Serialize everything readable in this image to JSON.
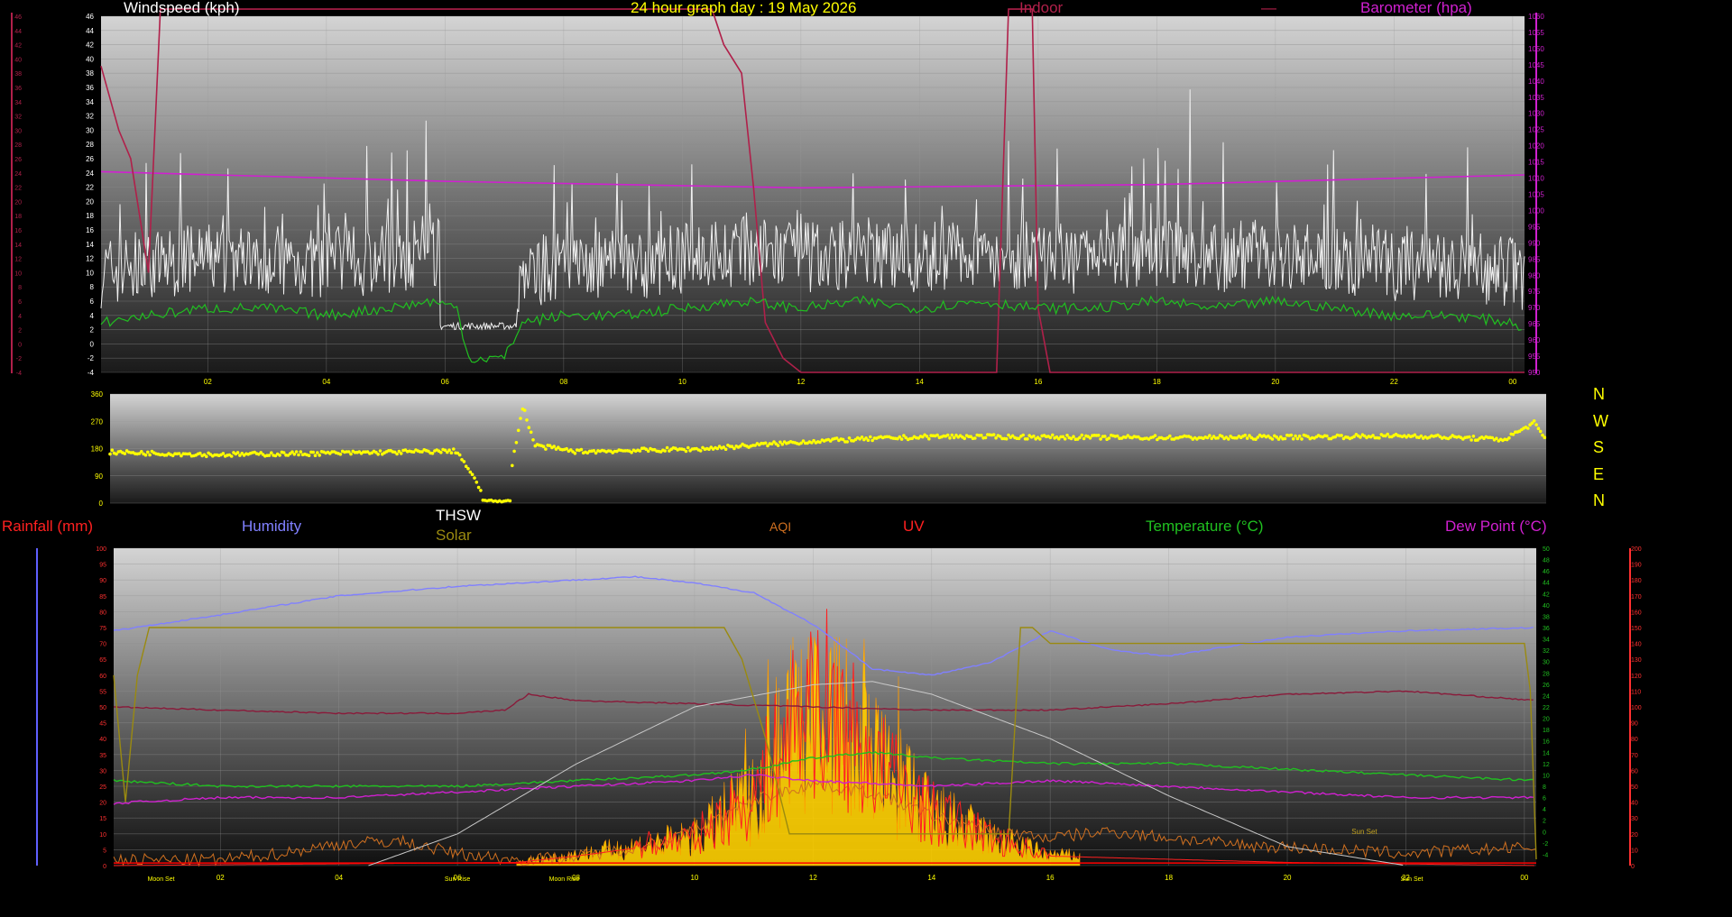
{
  "header": {
    "windspeed_label": "Windspeed (kph)",
    "title": "24 hour graph day : 19 May 2026",
    "indoor_label": "Indoor",
    "indoor_dash": "—",
    "barometer_label": "Barometer (hpa)"
  },
  "compass": [
    "N",
    "W",
    "S",
    "E",
    "N"
  ],
  "bottom_legend": {
    "rainfall": "Rainfall (mm)",
    "humidity": "Humidity",
    "thsw": "THSW",
    "solar": "Solar",
    "aqi": "AQI",
    "uv": "UV",
    "temperature": "Temperature (°C)",
    "dewpoint": "Dew Point (°C)"
  },
  "colors": {
    "wind": "#f0f0f0",
    "wind_avg": "#20c020",
    "indoor": "#b0204a",
    "barometer": "#d020d0",
    "direction": "#ffff00",
    "humidity": "#8080ff",
    "temperature": "#20c020",
    "dewpoint": "#d020d0",
    "solar": "#9a8a10",
    "solar_fill": "#ffd000",
    "uv": "#ff2020",
    "aqi": "#d07020",
    "thsw": "#8a1a3a",
    "sun_curve": "#c8c8c8",
    "rain": "#ff0000"
  },
  "chart_data": [
    {
      "type": "line",
      "title": "24 hour graph day : 19 May 2026",
      "x_ticks": [
        "02",
        "04",
        "06",
        "08",
        "10",
        "12",
        "14",
        "16",
        "18",
        "20",
        "22",
        "00"
      ],
      "x_range_hours": [
        0.2,
        24.2
      ],
      "y_left": {
        "label": "Windspeed (kph)",
        "range": [
          -4,
          46
        ],
        "ticks": [
          "46",
          "44",
          "42",
          "40",
          "38",
          "36",
          "34",
          "32",
          "30",
          "28",
          "26",
          "24",
          "22",
          "20",
          "18",
          "16",
          "14",
          "12",
          "10",
          "8",
          "6",
          "4",
          "2",
          "0",
          "-2",
          "-4"
        ]
      },
      "y_right": {
        "label": "Barometer (hpa)",
        "range": [
          950,
          1060
        ],
        "ticks": [
          "1060",
          "1055",
          "1050",
          "1045",
          "1040",
          "1035",
          "1030",
          "1025",
          "1020",
          "1015",
          "1010",
          "1005",
          "1000",
          "995",
          "990",
          "985",
          "980",
          "975",
          "970",
          "965",
          "960",
          "955",
          "950"
        ]
      },
      "series": [
        {
          "name": "Barometer (hpa)",
          "axis": "right",
          "x": [
            0.2,
            6,
            12,
            18,
            24.2
          ],
          "values": [
            1012,
            1009,
            1007,
            1008,
            1011
          ]
        },
        {
          "name": "Indoor",
          "axis": "left",
          "x": [
            0.2,
            0.5,
            0.7,
            1.0,
            1.2,
            1.5,
            10.5,
            10.7,
            11.0,
            11.2,
            11.4,
            11.7,
            12.0,
            15.3,
            15.5,
            15.6,
            15.9,
            16.0,
            16.2,
            24.2
          ],
          "values": [
            39,
            30,
            26,
            10,
            47,
            47,
            47,
            42,
            38,
            22,
            3,
            -2,
            -4,
            -4,
            47,
            47,
            47,
            5,
            -4,
            -4
          ]
        },
        {
          "name": "Wind average",
          "axis": "left",
          "x": [
            0.2,
            1,
            2,
            3,
            4,
            5,
            5.8,
            6.2,
            6.4,
            7.0,
            7.3,
            8,
            9,
            10,
            11,
            12,
            13,
            14,
            15,
            16,
            17,
            18,
            19,
            20,
            21,
            22,
            23,
            24,
            24.2
          ],
          "values": [
            3,
            4,
            5,
            5,
            4,
            5,
            6,
            5,
            -2,
            -2,
            3,
            4,
            4,
            5,
            6,
            5,
            6,
            5,
            6,
            5,
            5,
            6,
            5,
            6,
            5,
            4,
            4,
            3,
            2
          ]
        }
      ]
    },
    {
      "type": "scatter",
      "name": "Wind direction",
      "y_range": [
        0,
        360
      ],
      "y_ticks": [
        "360",
        "270",
        "180",
        "90",
        "0"
      ],
      "x": [
        0.2,
        2,
        4,
        6,
        6.5,
        6.6,
        6.8,
        7.1,
        7.3,
        8,
        10,
        12,
        14,
        16,
        18,
        20,
        22,
        23.5,
        24,
        24.2
      ],
      "values": [
        168,
        160,
        165,
        172,
        10,
        8,
        5,
        320,
        190,
        170,
        178,
        205,
        220,
        218,
        216,
        218,
        222,
        210,
        265,
        205
      ]
    },
    {
      "type": "line",
      "x_ticks": [
        "02",
        "04",
        "06",
        "08",
        "10",
        "12",
        "14",
        "16",
        "18",
        "20",
        "22",
        "00"
      ],
      "x_range_hours": [
        0.2,
        24.2
      ],
      "annotations": [
        "Moon Set",
        "Sun Rise",
        "Moon Rise",
        "Sun Set"
      ],
      "inside_labels": [
        "Sun Set"
      ],
      "y_left_percent": {
        "range": [
          0,
          100
        ],
        "ticks": [
          "100",
          "95",
          "90",
          "85",
          "80",
          "75",
          "70",
          "65",
          "60",
          "55",
          "50",
          "45",
          "40",
          "35",
          "30",
          "25",
          "20",
          "15",
          "10",
          "5",
          "0"
        ]
      },
      "y_rain_mm": {
        "label": "Rainfall (mm)",
        "range": [
          0,
          20
        ]
      },
      "y_temp": {
        "label": "Temperature (°C)",
        "range": [
          -6,
          50
        ],
        "ticks": [
          "50",
          "48",
          "46",
          "44",
          "42",
          "40",
          "38",
          "36",
          "34",
          "32",
          "30",
          "28",
          "26",
          "24",
          "22",
          "20",
          "18",
          "16",
          "14",
          "12",
          "10",
          "8",
          "6",
          "4",
          "2",
          "0",
          "-2",
          "-4"
        ]
      },
      "y_solar": {
        "label": "Solar",
        "range": [
          0,
          200
        ],
        "ticks": [
          "200",
          "190",
          "180",
          "170",
          "160",
          "150",
          "140",
          "130",
          "120",
          "110",
          "100",
          "90",
          "80",
          "70",
          "60",
          "50",
          "40",
          "30",
          "20",
          "10",
          "0"
        ]
      },
      "series": [
        {
          "name": "Humidity",
          "axis": "percent",
          "x": [
            0.2,
            2,
            4,
            6,
            8,
            9,
            10,
            11,
            12,
            13,
            14,
            15,
            16,
            17,
            18,
            19,
            20,
            22,
            24.2
          ],
          "values": [
            74,
            79,
            85,
            88,
            90,
            91,
            89,
            86,
            76,
            62,
            60,
            64,
            74,
            68,
            66,
            69,
            72,
            74,
            75
          ]
        },
        {
          "name": "THSW",
          "axis": "percent",
          "x": [
            0.2,
            2,
            4,
            6,
            6.8,
            7.2,
            8,
            10,
            12,
            14,
            16,
            18,
            20,
            22,
            24.2
          ],
          "values": [
            50,
            49,
            48,
            48,
            49,
            54,
            52,
            51,
            50,
            49,
            49,
            51,
            54,
            55,
            52
          ]
        },
        {
          "name": "Temperature (°C)",
          "axis": "temp",
          "x": [
            0.2,
            2,
            4,
            6,
            8,
            10,
            11,
            12,
            13,
            14,
            16,
            18,
            20,
            22,
            24.2
          ],
          "values": [
            9,
            8,
            8,
            8,
            9,
            10,
            11,
            13,
            14,
            13,
            12,
            12,
            11,
            10,
            9
          ]
        },
        {
          "name": "Dew Point (°C)",
          "axis": "temp",
          "x": [
            0.2,
            2,
            4,
            6,
            8,
            10,
            11,
            12,
            14,
            16,
            18,
            20,
            22,
            24.2
          ],
          "values": [
            5,
            6,
            6,
            7,
            8,
            9,
            10,
            9,
            8,
            9,
            8,
            7,
            6,
            6
          ]
        },
        {
          "name": "Solar",
          "axis": "percent",
          "x": [
            0.2,
            0.4,
            0.6,
            0.8,
            10.5,
            10.8,
            11.2,
            11.6,
            15.3,
            15.5,
            15.7,
            16.0,
            24.0,
            24.1,
            24.2
          ],
          "values": [
            60,
            20,
            60,
            75,
            75,
            65,
            40,
            10,
            10,
            75,
            75,
            70,
            70,
            55,
            2
          ]
        },
        {
          "name": "AQI",
          "axis": "percent",
          "x": [
            0.2,
            2,
            3,
            4,
            5,
            6,
            7,
            8,
            9,
            10,
            11,
            12,
            13,
            14,
            15,
            16,
            17,
            18,
            19,
            20,
            21,
            22,
            23,
            24.2
          ],
          "values": [
            1,
            1,
            3,
            6,
            7,
            3,
            1,
            2,
            5,
            10,
            20,
            25,
            22,
            15,
            10,
            8,
            10,
            8,
            6,
            5,
            4,
            3,
            4,
            5
          ]
        },
        {
          "name": "UV",
          "axis": "percent",
          "x": [
            0.2,
            7,
            8,
            10,
            11,
            11.5,
            12,
            12.5,
            13,
            14,
            15,
            16,
            18,
            20,
            24.2
          ],
          "values": [
            0,
            1,
            3,
            8,
            20,
            35,
            50,
            40,
            30,
            15,
            8,
            3,
            2,
            1,
            0
          ]
        },
        {
          "name": "Sun elevation",
          "axis": "percent",
          "x": [
            4.5,
            6,
            8,
            10,
            12,
            13,
            14,
            16,
            18,
            20,
            22
          ],
          "values": [
            0,
            10,
            32,
            50,
            57,
            58,
            54,
            40,
            22,
            6,
            0
          ]
        }
      ]
    }
  ]
}
